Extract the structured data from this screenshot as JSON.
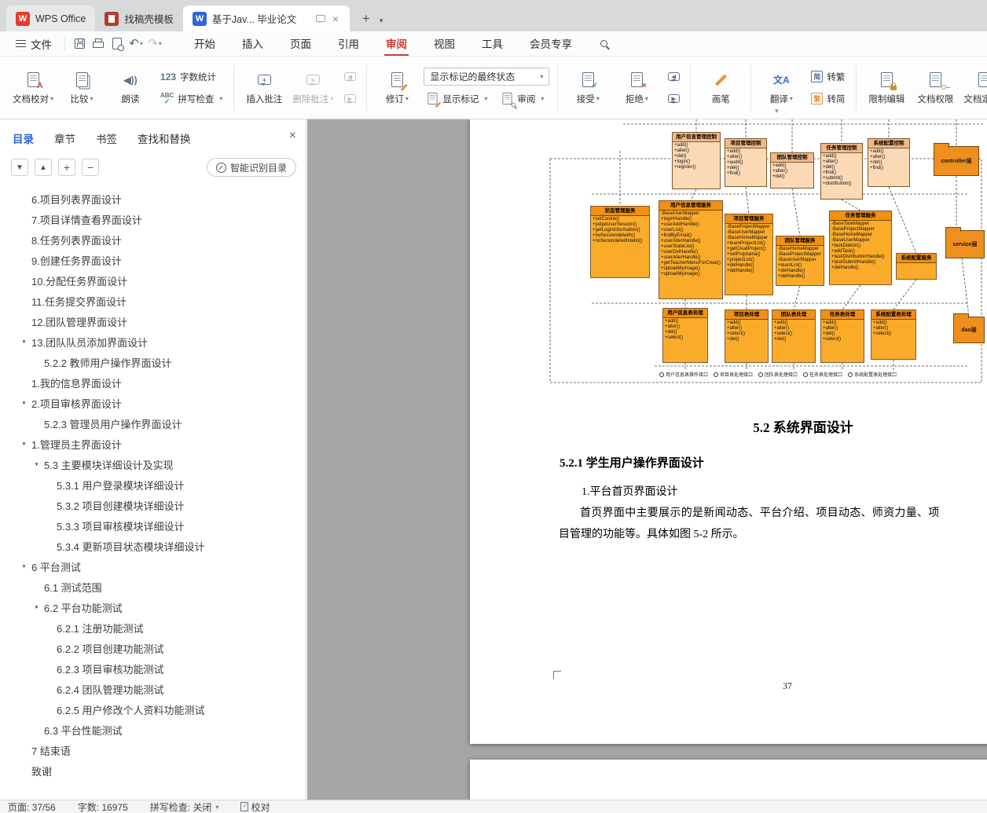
{
  "window": {
    "tabs": [
      {
        "label": "WPS Office"
      },
      {
        "label": "找稿壳模板"
      },
      {
        "label": "基于Jav... 毕业论文"
      }
    ]
  },
  "menu": {
    "file": "文件",
    "items": [
      "开始",
      "插入",
      "页面",
      "引用",
      "审阅",
      "视图",
      "工具",
      "会员专享"
    ],
    "active": "审阅"
  },
  "ribbon": {
    "doc_proof": "文档校对",
    "compare": "比较",
    "read_aloud": "朗读",
    "word_count": "字数统计",
    "spell_check": "拼写检查",
    "insert_comment": "插入批注",
    "delete_comment": "删除批注",
    "track_changes": "修订",
    "markup_state": "显示标记的最终状态",
    "show_markup": "显示标记",
    "review": "审阅",
    "accept": "接受",
    "reject": "拒绝",
    "brush": "画笔",
    "translate": "翻译",
    "jian": "简",
    "fan": "繁",
    "to_traditional": "转繁",
    "to_simplified": "转简",
    "restrict_edit": "限制编辑",
    "doc_permission": "文档权限",
    "doc_final": "文档定稿"
  },
  "panel": {
    "tabs": [
      "目录",
      "章节",
      "书签",
      "查找和替换"
    ],
    "smart": "智能识别目录",
    "toc": [
      {
        "label": "6.项目列表界面设计",
        "level": 1,
        "arrow": false
      },
      {
        "label": "7.项目详情查看界面设计",
        "level": 1,
        "arrow": false
      },
      {
        "label": "8.任务列表界面设计",
        "level": 1,
        "arrow": false
      },
      {
        "label": "9.创建任务界面设计",
        "level": 1,
        "arrow": false
      },
      {
        "label": "10.分配任务界面设计",
        "level": 1,
        "arrow": false
      },
      {
        "label": "11.任务提交界面设计",
        "level": 1,
        "arrow": false
      },
      {
        "label": "12.团队管理界面设计",
        "level": 1,
        "arrow": false
      },
      {
        "label": "13.团队队员添加界面设计",
        "level": 1,
        "arrow": true
      },
      {
        "label": "5.2.2 教师用户操作界面设计",
        "level": 2,
        "arrow": false
      },
      {
        "label": "1.我的信息界面设计",
        "level": 1,
        "arrow": false
      },
      {
        "label": "2.项目审核界面设计",
        "level": 1,
        "arrow": true
      },
      {
        "label": "5.2.3 管理员用户操作界面设计",
        "level": 2,
        "arrow": false
      },
      {
        "label": "1.管理员主界面设计",
        "level": 1,
        "arrow": true
      },
      {
        "label": "5.3 主要模块详细设计及实现",
        "level": 2,
        "arrow": true
      },
      {
        "label": "5.3.1 用户登录模块详细设计",
        "level": 3,
        "arrow": false
      },
      {
        "label": "5.3.2 项目创建模块详细设计",
        "level": 3,
        "arrow": false
      },
      {
        "label": "5.3.3 项目审核模块详细设计",
        "level": 3,
        "arrow": false
      },
      {
        "label": "5.3.4 更新项目状态模块详细设计",
        "level": 3,
        "arrow": false
      },
      {
        "label": "6 平台测试",
        "level": 1,
        "arrow": true
      },
      {
        "label": "6.1 测试范围",
        "level": 2,
        "arrow": false
      },
      {
        "label": "6.2 平台功能测试",
        "level": 2,
        "arrow": true
      },
      {
        "label": "6.2.1 注册功能测试",
        "level": 3,
        "arrow": false
      },
      {
        "label": "6.2.2 项目创建功能测试",
        "level": 3,
        "arrow": false
      },
      {
        "label": "6.2.3 项目审核功能测试",
        "level": 3,
        "arrow": false
      },
      {
        "label": "6.2.4 团队管理功能测试",
        "level": 3,
        "arrow": false
      },
      {
        "label": "6.2.5 用户修改个人资料功能测试",
        "level": 3,
        "arrow": false
      },
      {
        "label": "6.3 平台性能测试",
        "level": 2,
        "arrow": false
      },
      {
        "label": "7 结束语",
        "level": 1,
        "arrow": false
      },
      {
        "label": "致谢",
        "level": 1,
        "arrow": false
      }
    ]
  },
  "document": {
    "heading_52": "5.2  系统界面设计",
    "heading_521": "5.2.1  学生用户操作界面设计",
    "sub_1": "1.平台首页界面设计",
    "para_1": "首页界面中主要展示的是新闻动态、平台介绍、项目动态、师资力量、项",
    "para_2": "目管理的功能等。具体如图 5-2 所示。",
    "page_number": "37"
  },
  "statusbar": {
    "page": "页面: 37/56",
    "words": "字数: 16975",
    "spell": "拼写检查: 关闭",
    "proof": "校对"
  },
  "diagram": {
    "controllers": [
      {
        "title": "用户信息管理控制",
        "body": "+add()\n+alter()\n+del()\n+login()\n+register()"
      },
      {
        "title": "项目管理控制",
        "body": "+add()\n+alter()\n+audit()\n+del()\n+find()"
      },
      {
        "title": "团队管理控制",
        "body": "+add()\n+alter()\n+del()"
      },
      {
        "title": "任务管理控制",
        "body": "+add()\n+alter()\n+del()\n+find()\n+submit()\n+distribution()"
      },
      {
        "title": "系统配置控制",
        "body": "+add()\n+alter()\n+del()\n+find()"
      }
    ],
    "services": [
      {
        "title": "状态管理服务",
        "body": "+setCookie()\n+judgeUserSession()\n+getLoginInformation()\n+noSessiondelwith()\n+noSeriondelwithdebit()"
      },
      {
        "title": "用户信息管理服务",
        "body": "-BaseUserMapper\n+loginHandle()\n+userAddHandle()\n+userList()\n+findByEmail()\n+userAlterHandle()\n+userStateList()\n+userDelHandle()\n+userAlterHandle()\n+getTeacherMenuForCreat()\n+uploadMyimage()\n+uploadMyimage()"
      },
      {
        "title": "项目管理服务",
        "body": "-BaseProjectMapper\n-BaseUserMapper\n-BaseHomeMapper\n+teamProjectList()\n+getCreatProject()\n+setProjstama()\n+projectList()\n+delHandle()\n+delHandle()"
      },
      {
        "title": "团队管理服务",
        "body": "-BaseHomeMapper\n-BaseProjectMapper\n-BaseUserMapper\n+teamList()\n+delHandle()\n+delHandle()"
      },
      {
        "title": "任务管理服务",
        "body": "-BaseTaskMapper\n-BaseProjectMapper\n-BaseHomeMapper\n-BaseUserMapper\n+taskDiakon()\n+addTask()\n+taskDistributionHandle()\n+taskSubmitHandle()\n+delHandle()"
      },
      {
        "title": "系统配置服务",
        "body": ""
      }
    ],
    "daos": [
      {
        "title": "用户信息表处理",
        "body": "+add()\n+alter()\n+del()\n+select()"
      },
      {
        "title": "项目表处理",
        "body": "+add()\n+alter()\n+select()\n+del()"
      },
      {
        "title": "团队表处理",
        "body": "+add()\n+alter()\n+select()\n+del()"
      },
      {
        "title": "任务表处理",
        "body": "+add()\n+alter()\n+del()\n+select()"
      },
      {
        "title": "系统配置表处理",
        "body": "+add()\n+alter()\n+select()"
      }
    ],
    "layers": [
      {
        "label": "controller层"
      },
      {
        "label": "service层"
      },
      {
        "label": "dao层"
      }
    ],
    "interfaces": [
      {
        "label": "用户信息表操作接口"
      },
      {
        "label": "项目表处理接口"
      },
      {
        "label": "团队表处理接口"
      },
      {
        "label": "任务表处理接口"
      },
      {
        "label": "系统配置表处理接口"
      }
    ]
  }
}
